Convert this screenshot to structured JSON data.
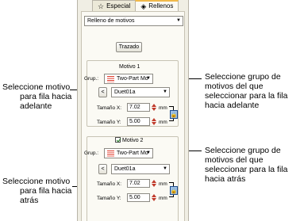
{
  "tabs": {
    "especial": {
      "label": "Especial",
      "icon": "star-icon"
    },
    "rellenos": {
      "label": "Rellenos",
      "icon": "fill-icon"
    }
  },
  "fill_type": {
    "value": "Relleno de motivos"
  },
  "trazado_button": {
    "label": "Trazado"
  },
  "motif1": {
    "title": "Motivo 1",
    "group_label": "Grup.:",
    "group_value": "Two-Part Mo",
    "nav_button": "<",
    "motif_value": "Duet01a",
    "size_x_label": "Tamaño X:",
    "size_x_value": "7.02",
    "size_x_unit": "mm",
    "size_y_label": "Tamaño Y:",
    "size_y_value": "5.00",
    "size_y_unit": "mm",
    "lock_icon": "lock-icon"
  },
  "motif2": {
    "title": "Motivo 2",
    "checked": true,
    "group_label": "Grup.:",
    "group_value": "Two-Part Mo",
    "nav_button": "<",
    "motif_value": "Duet01a",
    "size_x_label": "Tamaño X:",
    "size_x_value": "7.02",
    "size_x_unit": "mm",
    "size_y_label": "Tamaño Y:",
    "size_y_value": "5.00",
    "size_y_unit": "mm",
    "lock_icon": "lock-icon"
  },
  "callouts": {
    "left_1": [
      "Seleccione motivo",
      "para fila hacia",
      "adelante"
    ],
    "left_2": [
      "Seleccione motivo",
      "para fila hacia",
      "atrás"
    ],
    "right_1": [
      "Seleccione grupo de",
      "motivos del que",
      "seleccionar para la fila",
      "hacia adelante"
    ],
    "right_2": [
      "Seleccione grupo de",
      "motivos del que",
      "seleccionar para la fila",
      "hacia atrás"
    ]
  }
}
